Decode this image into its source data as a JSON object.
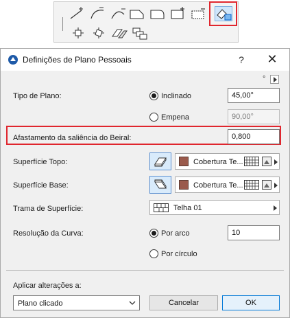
{
  "toolbar": {
    "icons": [
      "pen-pitch-icon",
      "arc-pitch-icon",
      "curve-pitch-icon",
      "corner-chamfer-icon",
      "corner-round-icon",
      "add-point-icon",
      "subtract-icon",
      "offset-edge-icon",
      "move-node-icon",
      "rotate-node-icon",
      "mirror-plane-icon",
      "stack-planes-icon"
    ]
  },
  "dialog": {
    "title": "Definições de Plano Pessoais",
    "help": "?",
    "close": "✕",
    "degree_mark": "°"
  },
  "tipo_de_plano": {
    "label": "Tipo de Plano:",
    "option_inclinado": "Inclinado",
    "inclinado_value": "45,00°",
    "option_empena": "Empena",
    "empena_value": "90,00°",
    "selected": "Inclinado"
  },
  "afastamento": {
    "label": "Afastamento da saliência do Beiral:",
    "value": "0,800"
  },
  "superficie_topo": {
    "label": "Superfície Topo:",
    "material": "Cobertura Te...",
    "swatch_color": "#9a5a4c"
  },
  "superficie_base": {
    "label": "Superfície Base:",
    "material": "Cobertura Te...",
    "swatch_color": "#9a5a4c"
  },
  "trama": {
    "label": "Trama de Superfície:",
    "value": "Telha 01"
  },
  "resolucao": {
    "label": "Resolução da Curva:",
    "option_por_arco": "Por arco",
    "por_arco_value": "10",
    "option_por_circulo": "Por círculo",
    "selected": "Por arco"
  },
  "aplicar": {
    "label": "Aplicar alterações a:",
    "value": "Plano clicado"
  },
  "buttons": {
    "cancel": "Cancelar",
    "ok": "OK"
  },
  "colors": {
    "highlight": "#e0262e",
    "accent": "#0078d7"
  }
}
